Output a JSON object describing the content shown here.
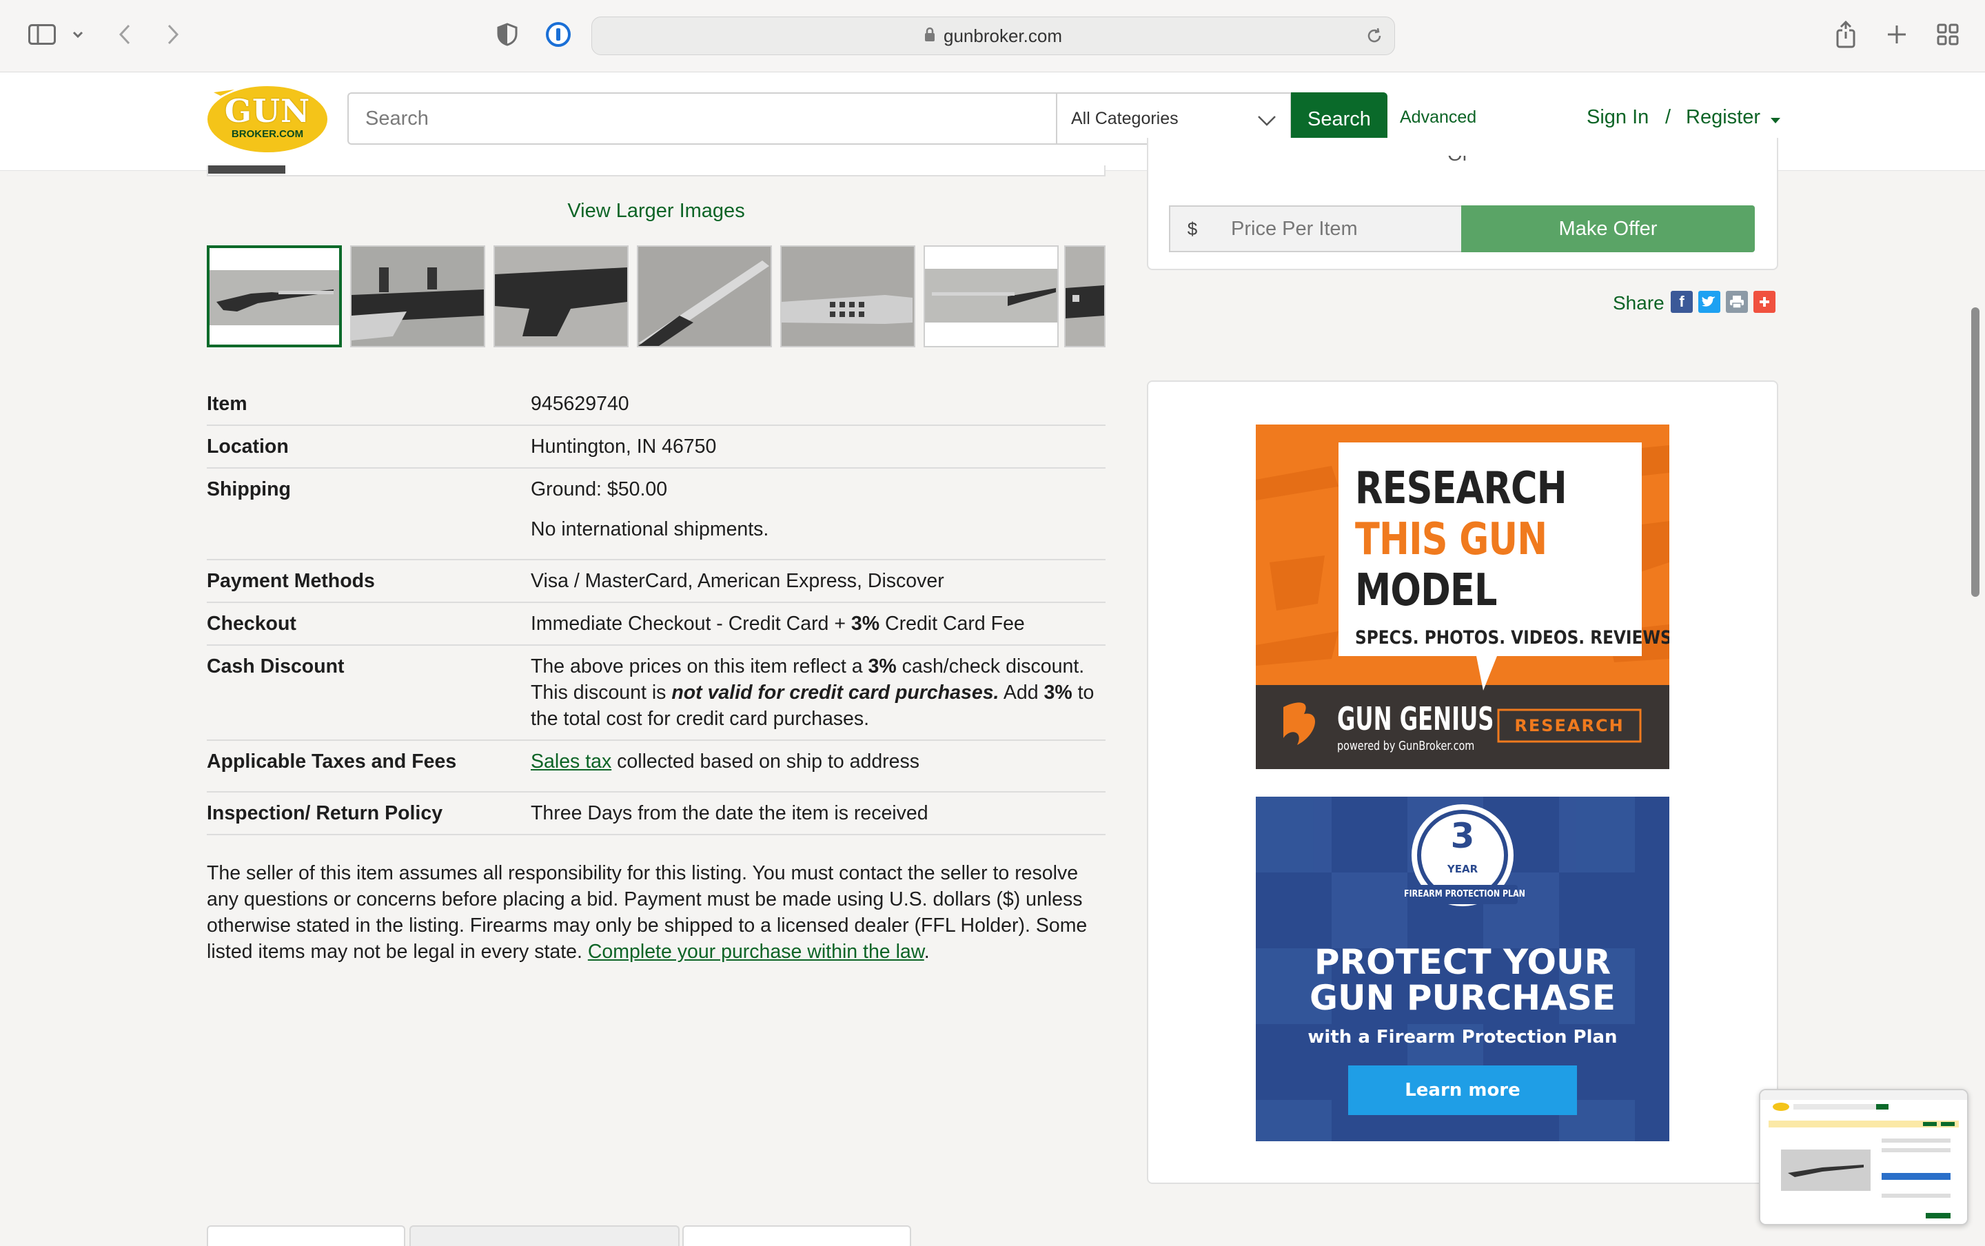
{
  "browser": {
    "url": "gunbroker.com"
  },
  "header": {
    "logo_top": "GUN",
    "logo_bottom": "BROKER.COM",
    "search_placeholder": "Search",
    "category": "All Categories",
    "search_button": "Search",
    "advanced": "Advanced",
    "sign_in": "Sign In",
    "separator": "/",
    "register": "Register"
  },
  "gallery": {
    "view_larger": "View Larger Images"
  },
  "details": {
    "item_label": "Item",
    "item_value": "945629740",
    "location_label": "Location",
    "location_value": "Huntington, IN 46750",
    "shipping_label": "Shipping",
    "shipping_value": "Ground: $50.00",
    "shipping_note": "No international shipments.",
    "payment_label": "Payment Methods",
    "payment_value": "Visa / MasterCard, American Express, Discover",
    "checkout_label": "Checkout",
    "checkout_pre": "Immediate Checkout - Credit Card + ",
    "checkout_bold": "3%",
    "checkout_post": " Credit Card Fee",
    "cash_label": "Cash Discount",
    "cash_1": "The above prices on this item reflect a ",
    "cash_2": "3%",
    "cash_3": " cash/check discount. This discount is ",
    "cash_4": "not valid for credit card purchases.",
    "cash_5": " Add ",
    "cash_6": "3%",
    "cash_7": " to the total cost for credit card purchases.",
    "taxes_label": "Applicable Taxes and Fees",
    "taxes_link": "Sales tax",
    "taxes_rest": " collected based on ship to address",
    "return_label": "Inspection/ Return Policy",
    "return_value": "Three Days from the date the item is received"
  },
  "disclaimer": {
    "text": "The seller of this item assumes all responsibility for this listing. You must contact the seller to resolve any questions or concerns before placing a bid. Payment must be made using U.S. dollars ($) unless otherwise stated in the listing. Firearms may only be shipped to a licensed dealer (FFL Holder). Some listed items may not be legal in every state. ",
    "link": "Complete your purchase within the law",
    "end": "."
  },
  "offer": {
    "or": "Or",
    "dollar": "$",
    "price_placeholder": "Price Per Item",
    "make_offer": "Make Offer"
  },
  "share": {
    "label": "Share"
  },
  "ad1": {
    "line1": "RESEARCH",
    "line2": "THIS GUN",
    "line3": "MODEL",
    "tagline": "SPECS. PHOTOS. VIDEOS. REVIEWS.",
    "brand": "GUN GENIUS",
    "powered": "powered by GunBroker.com",
    "button": "RESEARCH"
  },
  "ad2": {
    "badge_num": "3",
    "badge_year": "YEAR",
    "badge_text": "FIREARM PROTECTION PLAN",
    "headline1": "PROTECT YOUR",
    "headline2": "GUN PURCHASE",
    "sub": "with a Firearm Protection Plan",
    "button": "Learn more"
  },
  "colors": {
    "brand_green": "#0a6a2a",
    "offer_green": "#5aa466",
    "logo_yellow": "#f4c419",
    "ad_orange": "#f07a1e",
    "ad_blue": "#2b4a8e"
  }
}
